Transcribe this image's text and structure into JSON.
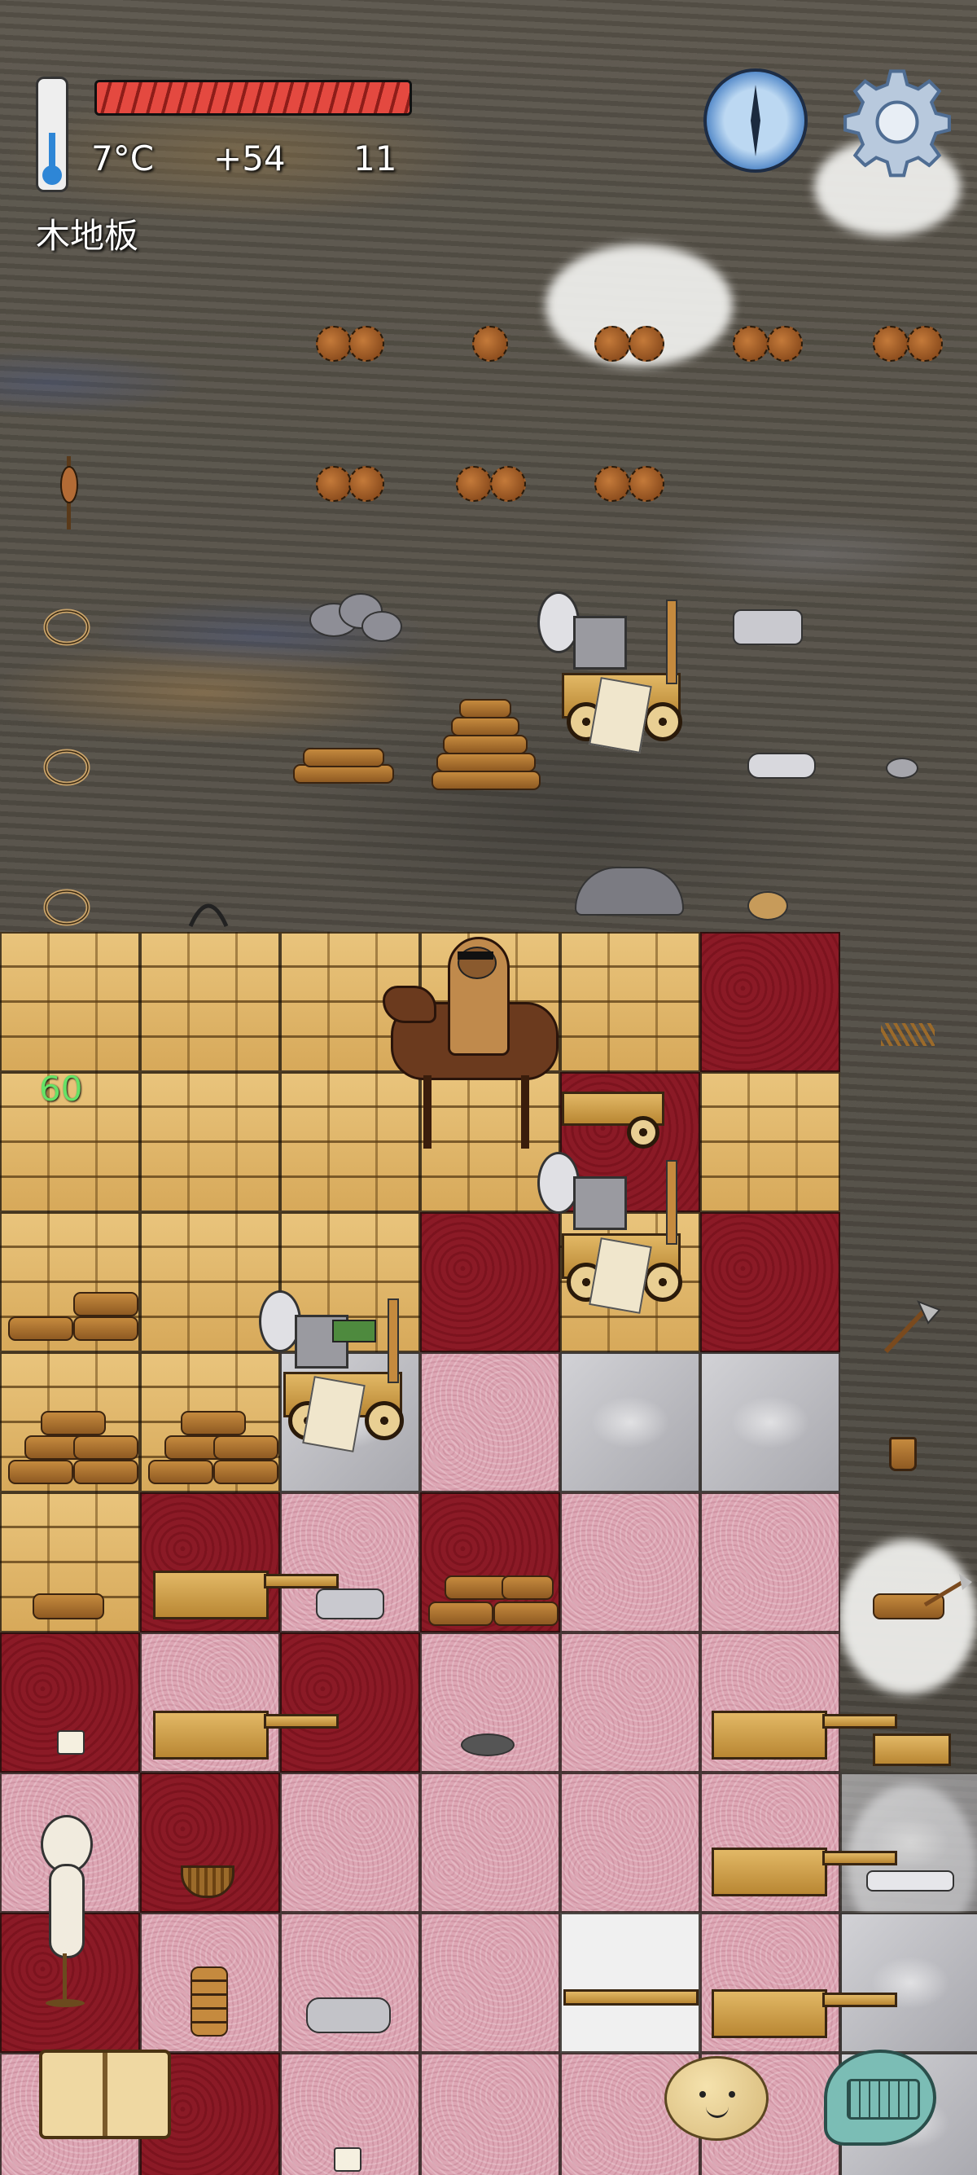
{
  "hud": {
    "temperature": "7°C",
    "food_bonus": "+54",
    "age": "11",
    "food_bar_level": 1.0,
    "tile_label": "木地板",
    "float_number": "60"
  },
  "icons": {
    "thermometer": "thermometer-icon",
    "compass": "compass-icon",
    "settings": "gear-icon",
    "recipe_book": "book-icon",
    "emote": "face-icon",
    "chat": "keyboard-icon"
  },
  "colors": {
    "food_bar": "#e44940",
    "thermo": "#2e86d6",
    "float_text": "#66e266",
    "wood_floor": "#e2b866",
    "carpet": "#8b1a26",
    "pink_floor": "#dda6b4",
    "stone_floor": "#c4c4c9"
  }
}
